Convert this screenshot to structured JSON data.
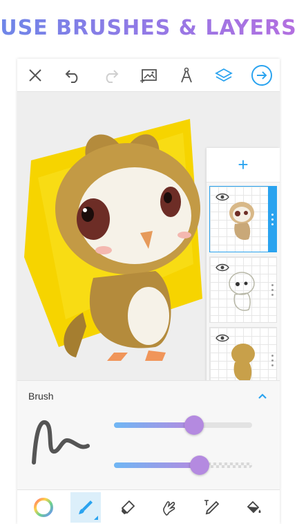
{
  "banner": {
    "title": "USE BRUSHES & LAYERS"
  },
  "toolbar": {
    "icons": [
      "close-icon",
      "undo-icon",
      "redo-icon",
      "add-image-icon",
      "compass-icon",
      "layers-icon",
      "next-icon"
    ],
    "accent_color": "#2aa3ef"
  },
  "layers": {
    "count": 3,
    "selected_index": 0,
    "items": [
      {
        "visible": true,
        "content": "owl-sketch-color"
      },
      {
        "visible": true,
        "content": "owl-sketch-lineart"
      },
      {
        "visible": true,
        "content": "owl-silhouette"
      }
    ]
  },
  "brush_panel": {
    "title": "Brush",
    "size_value": 0.58,
    "opacity_value": 0.62,
    "slider_color": "#b48ae0"
  },
  "bottom_tools": {
    "items": [
      "color-wheel",
      "brush",
      "eraser",
      "smudge",
      "text",
      "fill"
    ],
    "active": "brush"
  },
  "colors": {
    "canvas_bg": "#eeeeee",
    "highlight_yellow": "#f6d400",
    "owl_brown": "#c8a04a"
  }
}
